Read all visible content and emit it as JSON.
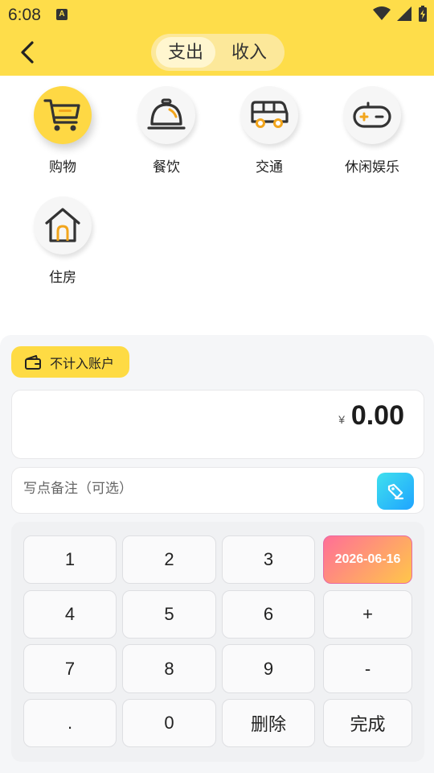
{
  "status_bar": {
    "time": "6:08",
    "badge": "A"
  },
  "header": {
    "tabs": [
      {
        "label": "支出",
        "active": true
      },
      {
        "label": "收入",
        "active": false
      }
    ]
  },
  "categories": [
    {
      "label": "购物",
      "icon": "shopping-cart-icon",
      "active": true
    },
    {
      "label": "餐饮",
      "icon": "dining-bell-icon",
      "active": false
    },
    {
      "label": "交通",
      "icon": "bus-icon",
      "active": false
    },
    {
      "label": "休闲娱乐",
      "icon": "gamepad-icon",
      "active": false
    },
    {
      "label": "住房",
      "icon": "house-icon",
      "active": false
    }
  ],
  "sheet": {
    "exclude_tag": "不计入账户",
    "currency": "¥",
    "amount": "0.00",
    "memo_placeholder": "写点备注（可选）"
  },
  "keypad": {
    "keys": [
      "1",
      "2",
      "3",
      "2026-06-16",
      "4",
      "5",
      "6",
      "+",
      "7",
      "8",
      "9",
      "-",
      ".",
      "0",
      "删除",
      "完成"
    ]
  },
  "colors": {
    "accent": "#fedd4a",
    "date_gradient_start": "#ff6f97",
    "date_gradient_end": "#ffc64a",
    "memo_button": "#1fa4ff"
  }
}
